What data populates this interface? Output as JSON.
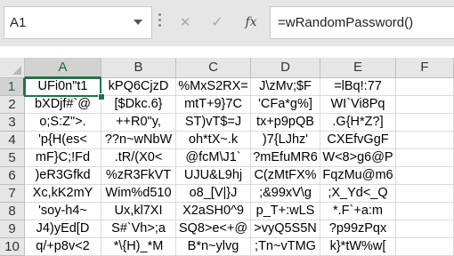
{
  "namebox": {
    "value": "A1"
  },
  "formula": {
    "text": "=wRandomPassword()",
    "fx_label": "fx",
    "cancel_glyph": "✕",
    "enter_glyph": "✓"
  },
  "columns": [
    "A",
    "B",
    "C",
    "D",
    "E",
    "F"
  ],
  "active_column": "A",
  "active_row": 1,
  "rows": [
    {
      "num": "1",
      "cells": [
        "UFi0n\"t1",
        "kPQ6CjzD",
        "%MxS2RX=",
        "J\\zMv;$F",
        "=lBq!:77",
        ""
      ]
    },
    {
      "num": "2",
      "cells": [
        "bXDjf#`@",
        "[$Dkc.6}",
        "mtT+9}7C",
        "'CFa*g%]",
        "WI`Vi8Pq",
        ""
      ]
    },
    {
      "num": "3",
      "cells": [
        "o;S:Z\">.",
        "++R0\"y,",
        "ST)vT$=J",
        "tx+p9pQB",
        ".G{H*Z?]",
        ""
      ]
    },
    {
      "num": "4",
      "cells": [
        "'p{H(es<",
        "??n~wNbW",
        "oh*tX~.k",
        ")7{LJhz'",
        "CXEfvGgF",
        ""
      ]
    },
    {
      "num": "5",
      "cells": [
        "mF}C;!Fd",
        ".tR/(X0<",
        "@fcM\\J1`",
        "?mEfuMR6",
        "W<8>g6@P",
        ""
      ]
    },
    {
      "num": "6",
      "cells": [
        ")eR3Gfkd",
        "%zR3FkVT",
        "UJU&L9hj",
        "C(zMtFX%",
        "FqzMu@m6",
        ""
      ]
    },
    {
      "num": "7",
      "cells": [
        "Xc,kK2mY",
        "Wim%d510",
        "o8_[V|}J",
        ";&99xV\\g",
        ";X_Yd<_Q",
        ""
      ]
    },
    {
      "num": "8",
      "cells": [
        "'soy-h4~",
        "Ux,kl7XI",
        "X2aSH0^9",
        "p_T+:wLS",
        "*.F`+a:m",
        ""
      ]
    },
    {
      "num": "9",
      "cells": [
        "J4)yEd[D",
        "S#`Vh>;a",
        "SQ8>e<+@",
        ">vyQ5S5N",
        "?p99zPqx",
        ""
      ]
    },
    {
      "num": "10",
      "cells": [
        "q/+p8v<2",
        "*\\{H)_*M",
        "B*n~ylvg",
        ";Tn~vTMG",
        "k}*tW%w[",
        ""
      ]
    }
  ]
}
